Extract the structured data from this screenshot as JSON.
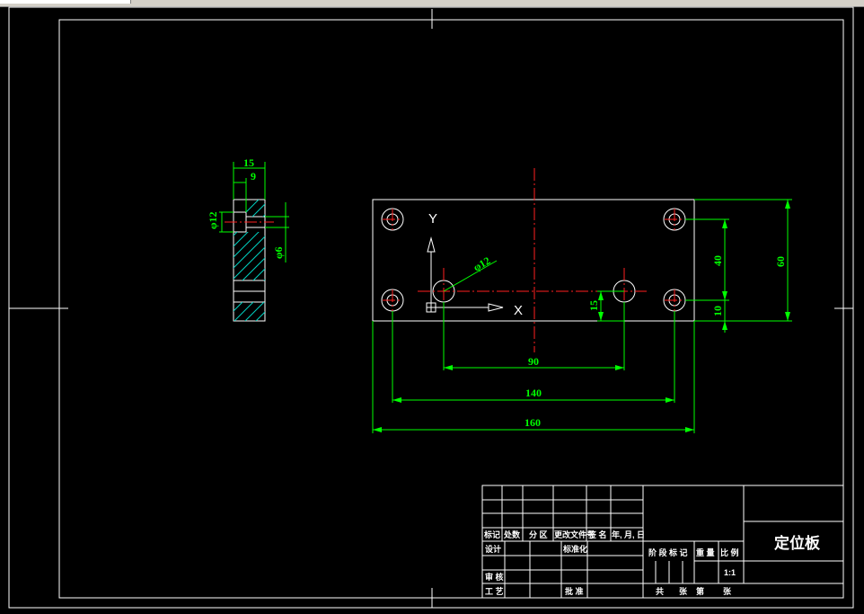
{
  "title_block": {
    "part_name": "定位板",
    "scale": "1:1",
    "header": [
      "标记",
      "处数",
      "分 区",
      "更改文件号",
      "签 名",
      "年, 月, 日"
    ],
    "design": "设计",
    "standardization": "标准化",
    "review": "审 核",
    "process": "工 艺",
    "approve": "批 准",
    "stage_mark": "阶 段 标 记",
    "weight": "重 量",
    "ratio": "比 例",
    "total": "共",
    "sheets": "张",
    "sheet_no": "第",
    "sheet_unit": "张"
  },
  "side_view": {
    "dim_width": "15",
    "dim_inner": "9",
    "dim_dia12": "φ12",
    "dim_dia6": "φ6"
  },
  "main_view": {
    "dim_length": "160",
    "dim_hole_span": "140",
    "dim_pin_span": "90",
    "dim_height": "60",
    "dim_hole_v": "40",
    "dim_hole_bottom": "10",
    "dim_pin_y": "15",
    "dim_pin_dia": "φ12",
    "axis_x": "X",
    "axis_y": "Y"
  },
  "colors": {
    "line": "#ffffff",
    "dimension": "#00ff00",
    "centerline": "#ff2020",
    "hatch": "#00d0c0"
  }
}
